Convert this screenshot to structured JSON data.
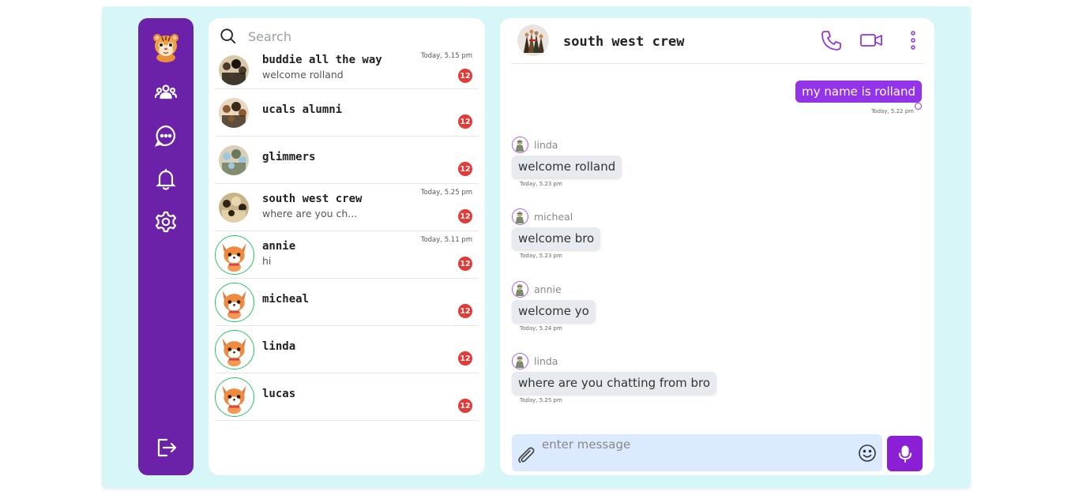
{
  "colors": {
    "frame_bg": "#d7f6f8",
    "rail": "#6b21a8",
    "accent": "#9333ea",
    "mic_button": "#8b1fd6",
    "badge": "#e53935",
    "online_ring": "#22c55e",
    "composer_bg": "#dbeafe"
  },
  "rail": {
    "avatar_icon": "tiger-avatar-icon",
    "items": [
      {
        "icon": "users-group-icon"
      },
      {
        "icon": "chat-bubble-icon"
      },
      {
        "icon": "bell-icon"
      },
      {
        "icon": "gear-icon"
      }
    ],
    "logout_icon": "logout-icon"
  },
  "search": {
    "placeholder": "Search",
    "icon": "search-icon"
  },
  "chats": [
    {
      "name": "buddie all the way",
      "preview": "welcome rolland",
      "time": "Today, 5.15 pm",
      "unread": "12",
      "online": false
    },
    {
      "name": "ucals alumni",
      "preview": "",
      "time": "",
      "unread": "12",
      "online": false
    },
    {
      "name": "glimmers",
      "preview": "",
      "time": "",
      "unread": "12",
      "online": false
    },
    {
      "name": "south west crew",
      "preview": "where are you ch...",
      "time": "Today, 5.25 pm",
      "unread": "12",
      "online": false
    },
    {
      "name": "annie",
      "preview": "hi",
      "time": "Today, 5.11 pm",
      "unread": "12",
      "online": true
    },
    {
      "name": "micheal",
      "preview": "",
      "time": "",
      "unread": "12",
      "online": true
    },
    {
      "name": "linda",
      "preview": "",
      "time": "",
      "unread": "12",
      "online": true
    },
    {
      "name": "lucas",
      "preview": "",
      "time": "",
      "unread": "12",
      "online": true
    }
  ],
  "conversation": {
    "title": "south west crew",
    "header_icons": [
      "phone-icon",
      "video-camera-icon",
      "more-vertical-icon"
    ],
    "outgoing": {
      "text": "my name is rolland",
      "time": "Today, 5.22 pm"
    },
    "incoming": [
      {
        "sender": "linda",
        "text": "welcome rolland",
        "time": "Today, 5.23 pm"
      },
      {
        "sender": "micheal",
        "text": "welcome bro",
        "time": "Today, 5.23 pm"
      },
      {
        "sender": "annie",
        "text": "welcome yo",
        "time": "Today, 5.24 pm"
      },
      {
        "sender": "linda",
        "text": "where are you chatting from bro",
        "time": "Today, 5.25 pm"
      }
    ]
  },
  "composer": {
    "placeholder": "enter message",
    "value": "",
    "attach_icon": "paperclip-icon",
    "emoji_icon": "smiley-icon",
    "mic_icon": "microphone-icon"
  }
}
